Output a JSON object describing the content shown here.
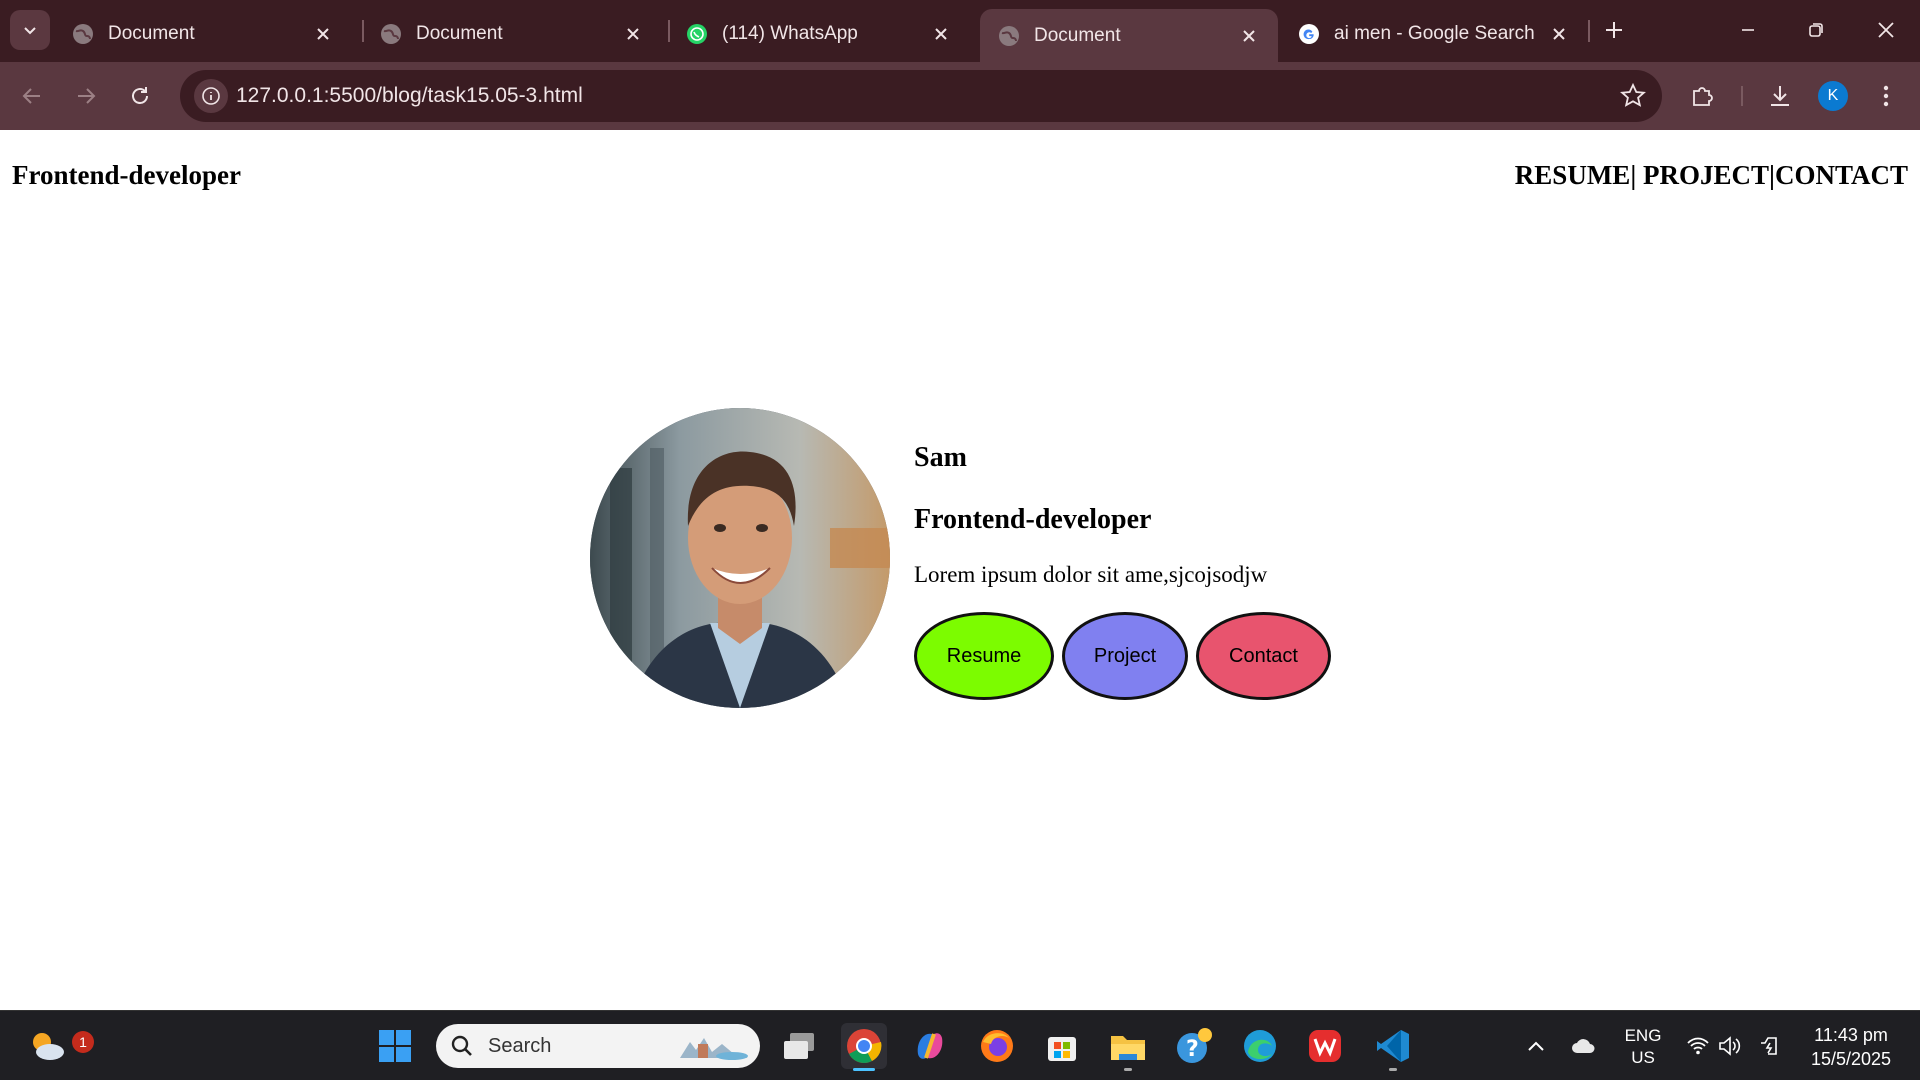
{
  "browser": {
    "tabs": [
      {
        "label": "Document",
        "favicon": "globe-icon",
        "active": false
      },
      {
        "label": "Document",
        "favicon": "globe-icon",
        "active": false
      },
      {
        "label": "(114) WhatsApp",
        "favicon": "whatsapp-icon",
        "active": false
      },
      {
        "label": "Document",
        "favicon": "globe-icon",
        "active": true
      },
      {
        "label": "ai men - Google Search",
        "favicon": "google-icon",
        "active": false
      }
    ],
    "url": "127.0.0.1:5500/blog/task15.05-3.html",
    "profile_initial": "K"
  },
  "page": {
    "brand": "Frontend-developer",
    "nav": {
      "resume": "RESUME",
      "sep1": "| ",
      "project": "PROJECT",
      "sep2": "|",
      "contact": "CONTACT"
    },
    "profile": {
      "name": "Sam",
      "role": "Frontend-developer",
      "description": "Lorem ipsum dolor sit ame,sjcojsodjw"
    },
    "buttons": [
      {
        "label": "Resume",
        "color": "#7cfc00"
      },
      {
        "label": "Project",
        "color": "#8080f0"
      },
      {
        "label": "Contact",
        "color": "#e8546e"
      }
    ]
  },
  "taskbar": {
    "search_label": "Search",
    "weather_badge": "1",
    "language": "ENG",
    "region": "US",
    "time": "11:43 pm",
    "date": "15/5/2025",
    "apps": [
      "start-icon",
      "task-view-icon",
      "chrome-icon",
      "copilot-icon",
      "firefox-icon",
      "store-icon",
      "file-explorer-icon",
      "help-icon",
      "edge-icon",
      "wps-icon",
      "vscode-icon"
    ]
  }
}
